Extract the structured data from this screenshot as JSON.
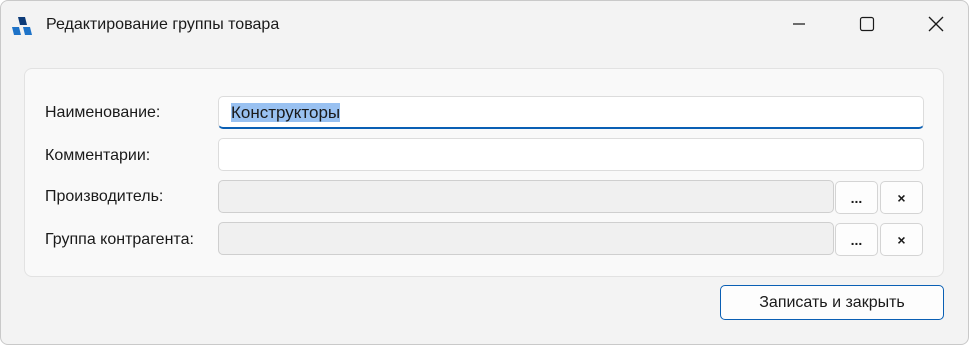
{
  "window": {
    "title": "Редактирование группы товара",
    "controls": {
      "minimize": "minimize-icon",
      "maximize": "maximize-icon",
      "close": "close-icon"
    }
  },
  "form": {
    "name": {
      "label": "Наименование:",
      "value": "Конструкторы"
    },
    "comment": {
      "label": "Комментарии:",
      "value": ""
    },
    "manufacturer": {
      "label": "Производитель:",
      "value": "",
      "select_label": "...",
      "clear_label": "×"
    },
    "counterparty_group": {
      "label": "Группа контрагента:",
      "value": "",
      "select_label": "...",
      "clear_label": "×"
    }
  },
  "actions": {
    "save_close_label": "Записать и закрыть"
  },
  "colors": {
    "accent": "#0a5fb4",
    "selection": "#99c1f1",
    "icon_blue": "#1e73c8",
    "icon_dark": "#0d3b78"
  }
}
